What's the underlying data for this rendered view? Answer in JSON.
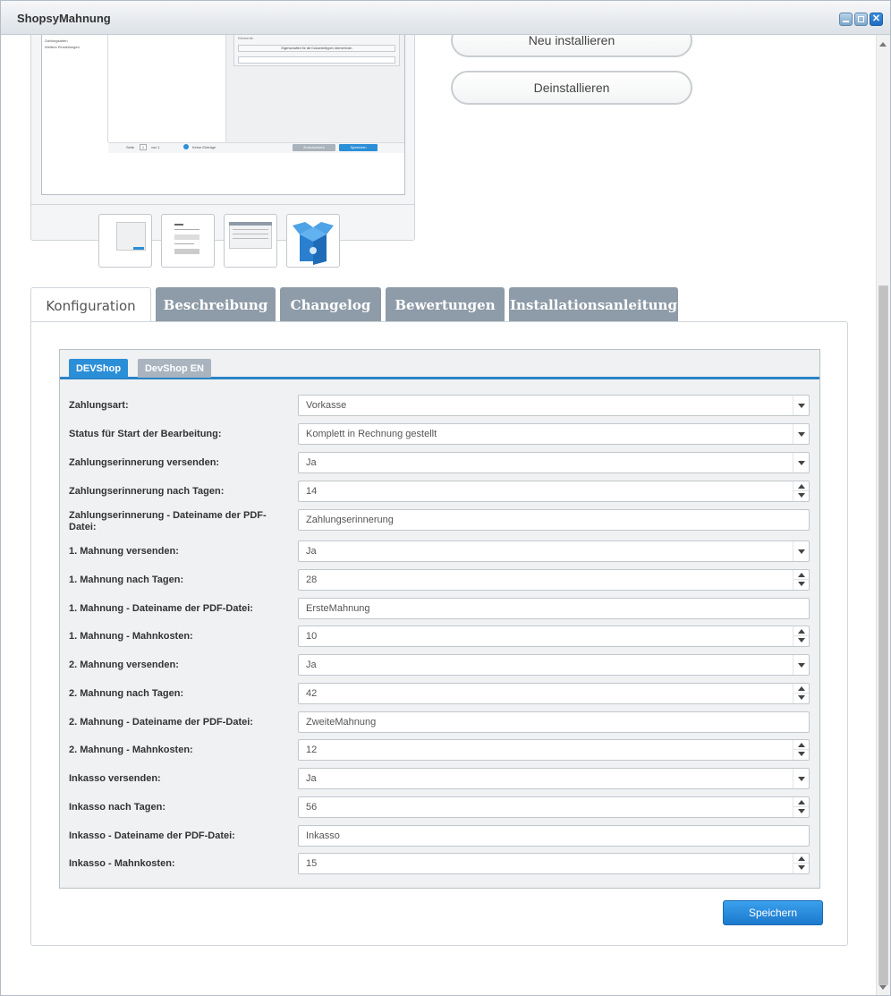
{
  "window": {
    "title": "ShopsyMahnung"
  },
  "actions": {
    "reinstall": "Neu installieren",
    "uninstall": "Deinstallieren"
  },
  "preview": {
    "panel_title": "Elemente",
    "tree_items": [
      "Zahlungsarten",
      "Weitere Einstellungen"
    ],
    "button_text": "Eigenschaften für die Dokumenttypen übernehmen",
    "page_label": "Seite",
    "page_value": "1",
    "of_label": "von 1",
    "no_entries": "Keine Einträge",
    "btn_reset": "Zurücksetzen",
    "btn_save": "Speichern"
  },
  "tabs": [
    {
      "label": "Konfiguration",
      "active": true
    },
    {
      "label": "Beschreibung",
      "active": false
    },
    {
      "label": "Changelog",
      "active": false
    },
    {
      "label": "Bewertungen",
      "active": false
    },
    {
      "label": "Installationsanleitung",
      "active": false
    }
  ],
  "shop_tabs": [
    {
      "label": "DEVShop",
      "active": true
    },
    {
      "label": "DevShop EN",
      "active": false
    }
  ],
  "form": {
    "rows": [
      {
        "label": "Zahlungsart:",
        "value": "Vorkasse",
        "type": "select"
      },
      {
        "label": "Status für Start der Bearbeitung:",
        "value": "Komplett in Rechnung gestellt",
        "type": "select"
      },
      {
        "label": "Zahlungserinnerung versenden:",
        "value": "Ja",
        "type": "select"
      },
      {
        "label": "Zahlungserinnerung nach Tagen:",
        "value": "14",
        "type": "number"
      },
      {
        "label": "Zahlungserinnerung - Dateiname der PDF-Datei:",
        "value": "Zahlungserinnerung",
        "type": "text"
      },
      {
        "label": "1. Mahnung versenden:",
        "value": "Ja",
        "type": "select"
      },
      {
        "label": "1. Mahnung nach Tagen:",
        "value": "28",
        "type": "number"
      },
      {
        "label": "1. Mahnung - Dateiname der PDF-Datei:",
        "value": "ErsteMahnung",
        "type": "text"
      },
      {
        "label": "1. Mahnung - Mahnkosten:",
        "value": "10",
        "type": "number"
      },
      {
        "label": "2. Mahnung versenden:",
        "value": "Ja",
        "type": "select"
      },
      {
        "label": "2. Mahnung nach Tagen:",
        "value": "42",
        "type": "number"
      },
      {
        "label": "2. Mahnung - Dateiname der PDF-Datei:",
        "value": "ZweiteMahnung",
        "type": "text"
      },
      {
        "label": "2. Mahnung - Mahnkosten:",
        "value": "12",
        "type": "number"
      },
      {
        "label": "Inkasso versenden:",
        "value": "Ja",
        "type": "select"
      },
      {
        "label": "Inkasso nach Tagen:",
        "value": "56",
        "type": "number"
      },
      {
        "label": "Inkasso - Dateiname der PDF-Datei:",
        "value": "Inkasso",
        "type": "text"
      },
      {
        "label": "Inkasso - Mahnkosten:",
        "value": "15",
        "type": "number"
      }
    ],
    "save_label": "Speichern"
  },
  "colors": {
    "accent": "#2b8fd8",
    "tab_inactive": "#8e9ba8"
  }
}
